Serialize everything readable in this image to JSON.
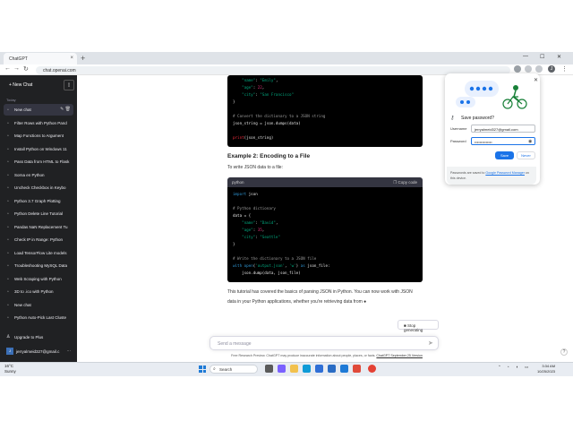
{
  "colors": {
    "sidebar": "#202123",
    "accent": "#1a73e8",
    "code_bg": "#000000"
  },
  "browser": {
    "tab_title": "ChatGPT",
    "tab_close": "×",
    "new_tab": "+",
    "url": "chat.openai.com",
    "minimize": "—",
    "maximize": "☐",
    "close": "✕",
    "back": "←",
    "forward": "→",
    "reload": "↻",
    "profile_letter": "J",
    "menu": "⋮"
  },
  "sidebar": {
    "new_chat": "+ New Chat",
    "toggle": "▯",
    "today": "Today",
    "items": [
      {
        "label": "New chat",
        "active": true
      },
      {
        "label": "Filter Rows with Python Pand"
      },
      {
        "label": "Map Functions to Argument"
      },
      {
        "label": "Install Python on Windows 11"
      },
      {
        "label": "Pass Data from HTML to Flask"
      },
      {
        "label": "Sorna en Python"
      },
      {
        "label": "Uncheck Checkbox in Keybo"
      },
      {
        "label": "Python 3.7 Graph Plotting"
      },
      {
        "label": "Python Delete Line Tutorial"
      },
      {
        "label": "Pandas NaN Replacement Tu"
      },
      {
        "label": "Check IP in Range: Python"
      },
      {
        "label": "Load TensorFlow Lite models"
      },
      {
        "label": "Troubleshooting MySQL Data"
      },
      {
        "label": "Web Scraping with Python"
      },
      {
        "label": "3D to .ico with Python"
      },
      {
        "label": "New chat"
      },
      {
        "label": "Python Auto-Pick Last Cluste"
      }
    ],
    "upgrade": "Upgrade to Plus",
    "user": "jerryalmeid327@gmail.c",
    "user_initial": "J",
    "more": "···"
  },
  "main": {
    "code1": {
      "lines": [
        [
          {
            "t": "    ",
            "c": ""
          },
          {
            "t": "\"name\"",
            "c": "str"
          },
          {
            "t": ": ",
            "c": ""
          },
          {
            "t": "\"Emily\"",
            "c": "str"
          },
          {
            "t": ",",
            "c": ""
          }
        ],
        [
          {
            "t": "    ",
            "c": ""
          },
          {
            "t": "\"age\"",
            "c": "str"
          },
          {
            "t": ": ",
            "c": ""
          },
          {
            "t": "22",
            "c": "num"
          },
          {
            "t": ",",
            "c": ""
          }
        ],
        [
          {
            "t": "    ",
            "c": ""
          },
          {
            "t": "\"city\"",
            "c": "str"
          },
          {
            "t": ": ",
            "c": ""
          },
          {
            "t": "\"San Francisco\"",
            "c": "str"
          }
        ],
        [
          {
            "t": "}",
            "c": ""
          }
        ],
        [
          {
            "t": "",
            "c": ""
          }
        ],
        [
          {
            "t": "# Convert the dictionary to a JSON string",
            "c": "cm"
          }
        ],
        [
          {
            "t": "json_string = json.dumps(data)",
            "c": ""
          }
        ],
        [
          {
            "t": "",
            "c": ""
          }
        ],
        [
          {
            "t": "print",
            "c": "fn"
          },
          {
            "t": "(json_string)",
            "c": ""
          }
        ]
      ]
    },
    "heading2": "Example 2: Encoding to a File",
    "para2": "To write JSON data to a file:",
    "code2": {
      "lang": "python",
      "copy": "Copy code",
      "lines": [
        [
          {
            "t": "import",
            "c": "kw"
          },
          {
            "t": " json",
            "c": ""
          }
        ],
        [
          {
            "t": "",
            "c": ""
          }
        ],
        [
          {
            "t": "# Python dictionary",
            "c": "cm"
          }
        ],
        [
          {
            "t": "data = {",
            "c": ""
          }
        ],
        [
          {
            "t": "    ",
            "c": ""
          },
          {
            "t": "\"name\"",
            "c": "str"
          },
          {
            "t": ": ",
            "c": ""
          },
          {
            "t": "\"David\"",
            "c": "str"
          },
          {
            "t": ",",
            "c": ""
          }
        ],
        [
          {
            "t": "    ",
            "c": ""
          },
          {
            "t": "\"age\"",
            "c": "str"
          },
          {
            "t": ": ",
            "c": ""
          },
          {
            "t": "35",
            "c": "num"
          },
          {
            "t": ",",
            "c": ""
          }
        ],
        [
          {
            "t": "    ",
            "c": ""
          },
          {
            "t": "\"city\"",
            "c": "str"
          },
          {
            "t": ": ",
            "c": ""
          },
          {
            "t": "\"Seattle\"",
            "c": "str"
          }
        ],
        [
          {
            "t": "}",
            "c": ""
          }
        ],
        [
          {
            "t": "",
            "c": ""
          }
        ],
        [
          {
            "t": "# Write the dictionary to a JSON file",
            "c": "cm"
          }
        ],
        [
          {
            "t": "with",
            "c": "kw"
          },
          {
            "t": " ",
            "c": ""
          },
          {
            "t": "open",
            "c": "kw"
          },
          {
            "t": "(",
            "c": ""
          },
          {
            "t": "'output.json'",
            "c": "str"
          },
          {
            "t": ", ",
            "c": ""
          },
          {
            "t": "'w'",
            "c": "str"
          },
          {
            "t": ") ",
            "c": ""
          },
          {
            "t": "as",
            "c": "kw"
          },
          {
            "t": " json_file:",
            "c": ""
          }
        ],
        [
          {
            "t": "    json.dump(data, json_file)",
            "c": ""
          }
        ]
      ]
    },
    "final_line1": "This tutorial has covered the basics of parsing JSON in Python. You can now work with JSON",
    "final_line2": "data in your Python applications, whether you're retrieving data from ●",
    "stop": "■ Stop generating",
    "send_placeholder": "Send a message",
    "send_icon": "➤",
    "footer_text": "Free Research Preview. ChatGPT may produce inaccurate information about people, places, or facts.",
    "footer_link": "ChatGPT September 25 Version",
    "help": "?"
  },
  "password_popup": {
    "title": "Save password?",
    "close": "✕",
    "key_icon": "⚷",
    "username_label": "Username",
    "username_value": "jerryalmeid327@gmail.com",
    "password_label": "Password",
    "password_value": "••••••••••••••",
    "eye": "◉",
    "save": "Save",
    "never": "Never",
    "note_prefix": "Passwords are saved to",
    "note_link": "Google Password Manager",
    "note_suffix": "on this device."
  },
  "taskbar": {
    "temp": "16°C",
    "weather": "Sunny",
    "search": "Search",
    "search_icon": "⌕",
    "tray_up": "⌃",
    "wifi": "◔",
    "sound": "◖",
    "battery": "▭",
    "lang": "ENG",
    "time": "3:34 AM",
    "date": "10/25/2023"
  }
}
